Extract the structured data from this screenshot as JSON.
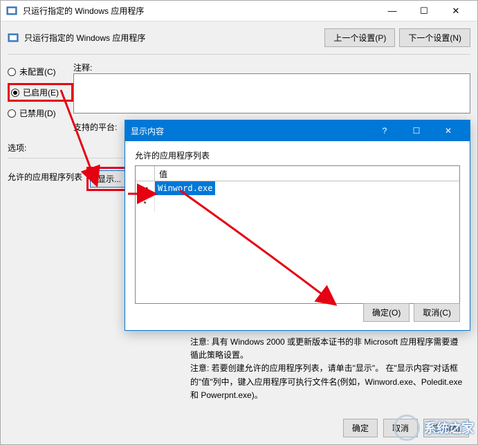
{
  "window": {
    "title": "只运行指定的 Windows 应用程序",
    "subtitle": "只运行指定的 Windows 应用程序",
    "prev_btn": "上一个设置(P)",
    "next_btn": "下一个设置(N)"
  },
  "radios": {
    "not_configured": "未配置(C)",
    "enabled": "已启用(E)",
    "disabled": "已禁用(D)"
  },
  "labels": {
    "comment": "注释:",
    "platform": "支持的平台:",
    "options": "选项:",
    "allowed_list": "允许的应用程序列表",
    "show": "显示..."
  },
  "dialog": {
    "title": "显示内容",
    "list_label": "允许的应用程序列表",
    "col_value": "值",
    "row_value": "Winword.exe",
    "ok": "确定(O)",
    "cancel": "取消(C)"
  },
  "help": {
    "line1": "注意: 具有 Windows 2000 或更新版本证书的非 Microsoft 应用程序需要遵循此策略设置。",
    "line2": "注意: 若要创建允许的应用程序列表，请单击\"显示\"。 在\"显示内容\"对话框的\"值\"列中，键入应用程序可执行文件名(例如，Winword.exe、Poledit.exe 和 Powerpnt.exe)。"
  },
  "bottom": {
    "ok": "确定",
    "cancel": "取消",
    "apply": "应用(A)"
  },
  "watermark": "系统之家"
}
